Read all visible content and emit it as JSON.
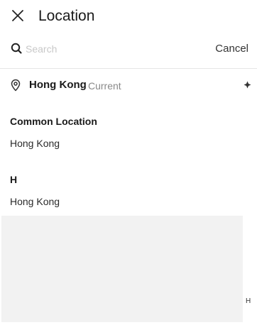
{
  "header": {
    "title": "Location",
    "close_icon": "close-icon"
  },
  "search": {
    "placeholder": "Search",
    "value": "",
    "icon": "search-icon",
    "cancel_label": "Cancel"
  },
  "current_location": {
    "city": "Hong Kong",
    "tag": "Current",
    "pin_icon": "location-pin-icon",
    "locate_icon": "locate-icon"
  },
  "common_section": {
    "title": "Common Location",
    "items": [
      "Hong Kong"
    ]
  },
  "h_section": {
    "title": "H",
    "items": [
      "Hong Kong"
    ]
  },
  "index_bar": {
    "letters": [
      "H"
    ]
  },
  "colors": {
    "primary_text": "#1a1a1a",
    "secondary_text": "#8a8a8a",
    "placeholder": "#c8c8c8",
    "divider": "#e6e6e6",
    "panel_bg": "#f2f2f2"
  }
}
